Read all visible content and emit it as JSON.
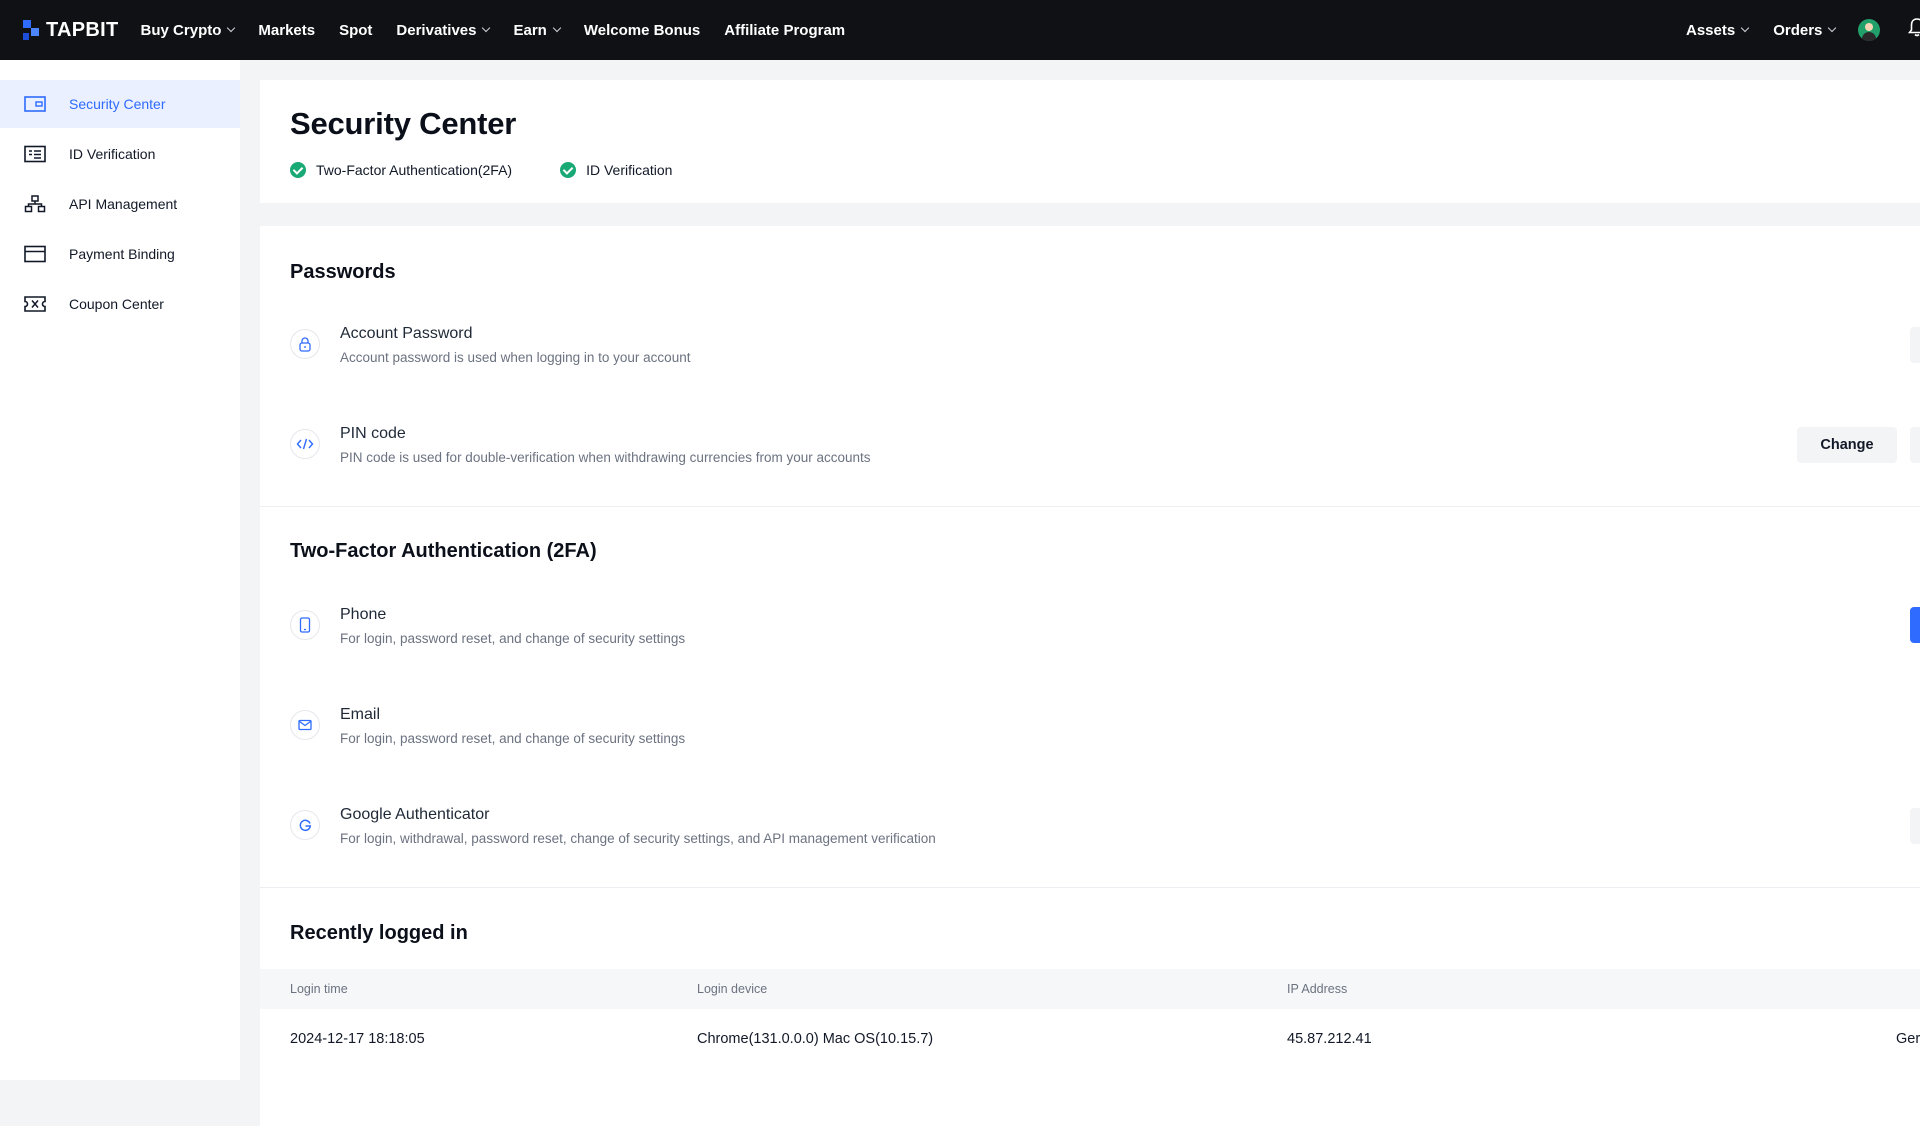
{
  "brand": {
    "name": "TAPBIT",
    "color": "#2f6bff"
  },
  "nav": {
    "items": [
      {
        "label": "Buy Crypto",
        "dropdown": true
      },
      {
        "label": "Markets",
        "dropdown": false
      },
      {
        "label": "Spot",
        "dropdown": false
      },
      {
        "label": "Derivatives",
        "dropdown": true
      },
      {
        "label": "Earn",
        "dropdown": true
      },
      {
        "label": "Welcome Bonus",
        "dropdown": false
      },
      {
        "label": "Affiliate Program",
        "dropdown": false
      }
    ],
    "right": [
      {
        "label": "Assets",
        "dropdown": true
      },
      {
        "label": "Orders",
        "dropdown": true
      }
    ],
    "icons": [
      "avatar",
      "bell-icon"
    ]
  },
  "sidebar": {
    "items": [
      {
        "label": "Security Center",
        "icon": "shield-wallet-icon",
        "active": true
      },
      {
        "label": "ID Verification",
        "icon": "id-card-icon",
        "active": false
      },
      {
        "label": "API Management",
        "icon": "api-hierarchy-icon",
        "active": false
      },
      {
        "label": "Payment Binding",
        "icon": "card-icon",
        "active": false
      },
      {
        "label": "Coupon Center",
        "icon": "ticket-icon",
        "active": false
      }
    ]
  },
  "header": {
    "title": "Security Center",
    "badges": [
      "Two-Factor Authentication(2FA)",
      "ID Verification"
    ],
    "badge_color": "#19a974"
  },
  "passwords": {
    "title": "Passwords",
    "rows": [
      {
        "title": "Account Password",
        "desc": "Account password is used when logging in to your account",
        "icon": "lock-icon"
      },
      {
        "title": "PIN code",
        "desc": "PIN code is used for double-verification when withdrawing currencies from your accounts",
        "icon": "code-icon",
        "button": "Change"
      }
    ]
  },
  "twofa": {
    "title": "Two-Factor Authentication (2FA)",
    "rows": [
      {
        "title": "Phone",
        "desc": "For login, password reset, and change of security settings",
        "icon": "phone-icon"
      },
      {
        "title": "Email",
        "desc": "For login, password reset, and change of security settings",
        "icon": "mail-icon"
      },
      {
        "title": "Google Authenticator",
        "desc": "For login, withdrawal, password reset, change of security settings, and API management verification",
        "icon": "google-icon"
      }
    ]
  },
  "logins": {
    "title": "Recently logged in",
    "columns": [
      "Login time",
      "Login device",
      "IP Address"
    ],
    "rows": [
      {
        "time": "2024-12-17 18:18:05",
        "device": "Chrome(131.0.0.0) Mac OS(10.15.7)",
        "ip": "45.87.212.41",
        "location": "Ger"
      }
    ]
  }
}
